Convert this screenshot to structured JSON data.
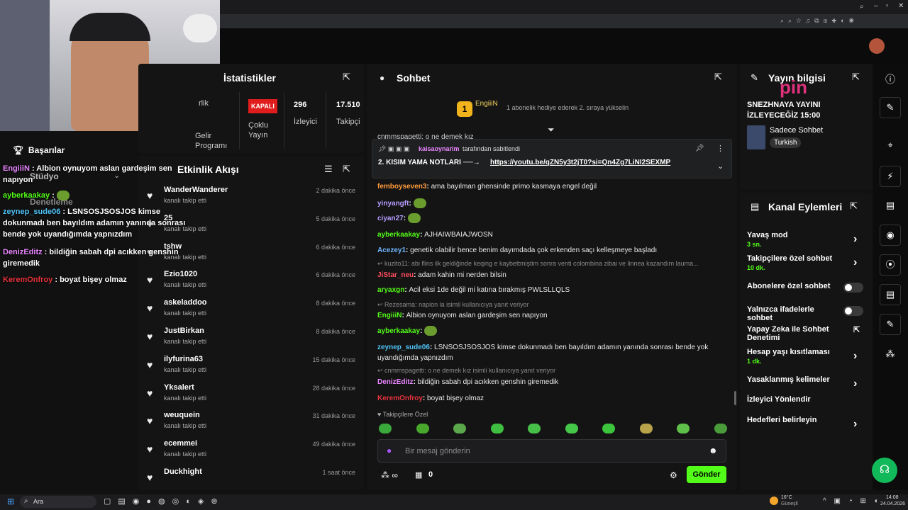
{
  "colors": {
    "accent": "#53fc18",
    "kapali": "#e01c1c",
    "overlay_red": "#e8323c"
  },
  "stats": {
    "title": "İstatistikler",
    "kapali": "KAPALI",
    "viewers": "296",
    "viewers_label": "İzleyici",
    "followers": "17.510",
    "followers_label": "Takipçi",
    "multi": "Çoklu Yayın",
    "gelir": "Gelir Programı",
    "rlik": "rlik"
  },
  "activity": {
    "title": "Etkinlik Akışı",
    "items": [
      {
        "name": "WanderWanderer",
        "sub": "kanalı takip etti",
        "time": "2 dakika önce"
      },
      {
        "name": "25",
        "sub": "kanalı takip etti",
        "time": "5 dakika önce"
      },
      {
        "name": "tshw",
        "sub": "kanalı takip etti",
        "time": "6 dakika önce"
      },
      {
        "name": "Ezio1020",
        "sub": "kanalı takip etti",
        "time": "6 dakika önce"
      },
      {
        "name": "askeladdoo",
        "sub": "kanalı takip etti",
        "time": "8 dakika önce"
      },
      {
        "name": "JustBirkan",
        "sub": "kanalı takip etti",
        "time": "8 dakika önce"
      },
      {
        "name": "ilyfurina63",
        "sub": "kanalı takip etti",
        "time": "15 dakika önce"
      },
      {
        "name": "Yksalert",
        "sub": "kanalı takip etti",
        "time": "28 dakika önce"
      },
      {
        "name": "weuquein",
        "sub": "kanalı takip etti",
        "time": "31 dakika önce"
      },
      {
        "name": "ecemmei",
        "sub": "kanalı takip etti",
        "time": "49 dakika önce"
      },
      {
        "name": "Duckhight",
        "sub": "",
        "time": "1 saat önce"
      }
    ]
  },
  "chat": {
    "title": "Sohbet",
    "top_user": "EngiiiN",
    "top_rank": "1",
    "gift_text": "1 abonelik hediye ederek 2. sıraya yükselin",
    "partial": "cnmmspagetti: o ne demek kız",
    "pinned_by": "kaisaoynarim",
    "pinned_suffix": "tarafından sabitlendi",
    "pinned_text": "2. KISIM YAMA NOTLARI ──→",
    "pinned_link": "https://youtu.be/qZN5y3t2jT0?si=Qn4Zg7LiNI2SEXMP",
    "messages": [
      {
        "user": "femboyseven3",
        "text": "ama bayılman ghensinde primo kasmaya engel değil",
        "color": "#ff9b3d"
      },
      {
        "user": "yinyangft",
        "text": "",
        "color": "#b59cff"
      },
      {
        "user": "ciyan27",
        "text": "",
        "color": "#b59cff"
      },
      {
        "user": "ayberkaakay",
        "text": "AJHAIWBAIAJWOSN",
        "color": "#53fc18"
      },
      {
        "user": "Acezey1",
        "text": "genetik olabilir bence benim dayımdada çok erkenden saçı kelleşmeye başladı",
        "color": "#6fb6ff"
      },
      {
        "reply": "kuzito11: abi flins ilk geldiğinde keqing e kaybettmiştim sonra venti colombina zibai ve linnea kazandım lauma..."
      },
      {
        "user": "JiStar_neu",
        "text": "adam kahin mi nerden bilsin",
        "color": "#ff4d5e"
      },
      {
        "user": "aryaxgn",
        "text": "Acil eksi 1de değil mi katına bırakmış PWLSLLQLS",
        "color": "#53fc18"
      },
      {
        "reply": "Rezesama: napion la isimli kullanıcıya yanıt veriyor"
      },
      {
        "user": "EngiiiN",
        "text": "Albion oynuyom aslan gardeşim sen napıyon",
        "color": "#53fc18"
      },
      {
        "user": "ayberkaakay",
        "text": "",
        "color": "#53fc18"
      },
      {
        "user": "zeynep_sude06",
        "text": "LSNSOSJSOSJOS kimse dokunmadı ben bayıldım adamın yanında sonrası bende yok uyandığımda yapnızdım",
        "color": "#4fc3f7"
      },
      {
        "reply": "cnmmspagetti: o ne demek kız isimli kullanıcıya yanıt veriyor"
      },
      {
        "user": "DenizEditz",
        "text": "bildiğin sabah dpi acıkken genshin giremedik",
        "color": "#e986ff"
      },
      {
        "user": "KeremOnfroy",
        "text": "boyat bişey olmaz",
        "color": "#e8323c"
      }
    ],
    "followers_only": "Takipçilere Özel",
    "input_placeholder": "Bir mesaj gönderin",
    "send": "Gönder",
    "count": "0"
  },
  "stream_info": {
    "title": "Yayın bilgisi",
    "line1": "SNEZHNAYA YAYINI",
    "line2": "İZLEYECEĞİZ 15:00",
    "category": "Sadece Sohbet",
    "tag": "Turkish"
  },
  "channel": {
    "title": "Kanal Eylemleri",
    "items": [
      {
        "label": "Yavaş mod",
        "sub": "3 sn.",
        "type": "chev"
      },
      {
        "label": "Takipçilere özel sohbet",
        "sub": "10 dk.",
        "type": "chev"
      },
      {
        "label": "Abonelere özel sohbet",
        "sub": "",
        "type": "toggle"
      },
      {
        "label": "Yalnızca ifadelerle sohbet",
        "sub": "",
        "type": "toggle"
      },
      {
        "label": "Yapay Zeka ile Sohbet Denetimi",
        "sub": "",
        "type": "ext"
      },
      {
        "label": "Hesap yaşı kısıtlaması",
        "sub": "1 dk.",
        "type": "chev"
      },
      {
        "label": "Yasaklanmış kelimeler",
        "sub": "",
        "type": "chev"
      },
      {
        "label": "İzleyici Yönlendir",
        "sub": "",
        "type": "none"
      },
      {
        "label": "Hedefleri belirleyin",
        "sub": "",
        "type": "chev"
      }
    ]
  },
  "overlay": {
    "achievements": "Başarılar",
    "studio": "Stüdyo",
    "moderation": "Denetleme",
    "msgs": [
      {
        "user": "EngiiiN",
        "text": "Albion oynuyom aslan gardeşim sen napıyon",
        "color": "#e986ff"
      },
      {
        "user": "ayberkaakay",
        "text": "",
        "color": "#53fc18"
      },
      {
        "user": "zeynep_sude06",
        "text": "LSNSOSJSOSJOS kimse dokunmadı ben bayıldım adamın yanında sonrası bende yok uyandığımda yapnızdım",
        "color": "#4fc3f7"
      },
      {
        "user": "DenizEditz",
        "text": "bildiğin sabah dpi acıkken genshin giremedik",
        "color": "#e986ff"
      },
      {
        "user": "KeremOnfroy",
        "text": "boyat bişey olmaz",
        "color": "#e8323c"
      }
    ]
  },
  "taskbar": {
    "search": "Ara",
    "weather": "16°C",
    "weather_sub": "Güneşli",
    "time": "14:08",
    "date": "24.04.2026"
  }
}
